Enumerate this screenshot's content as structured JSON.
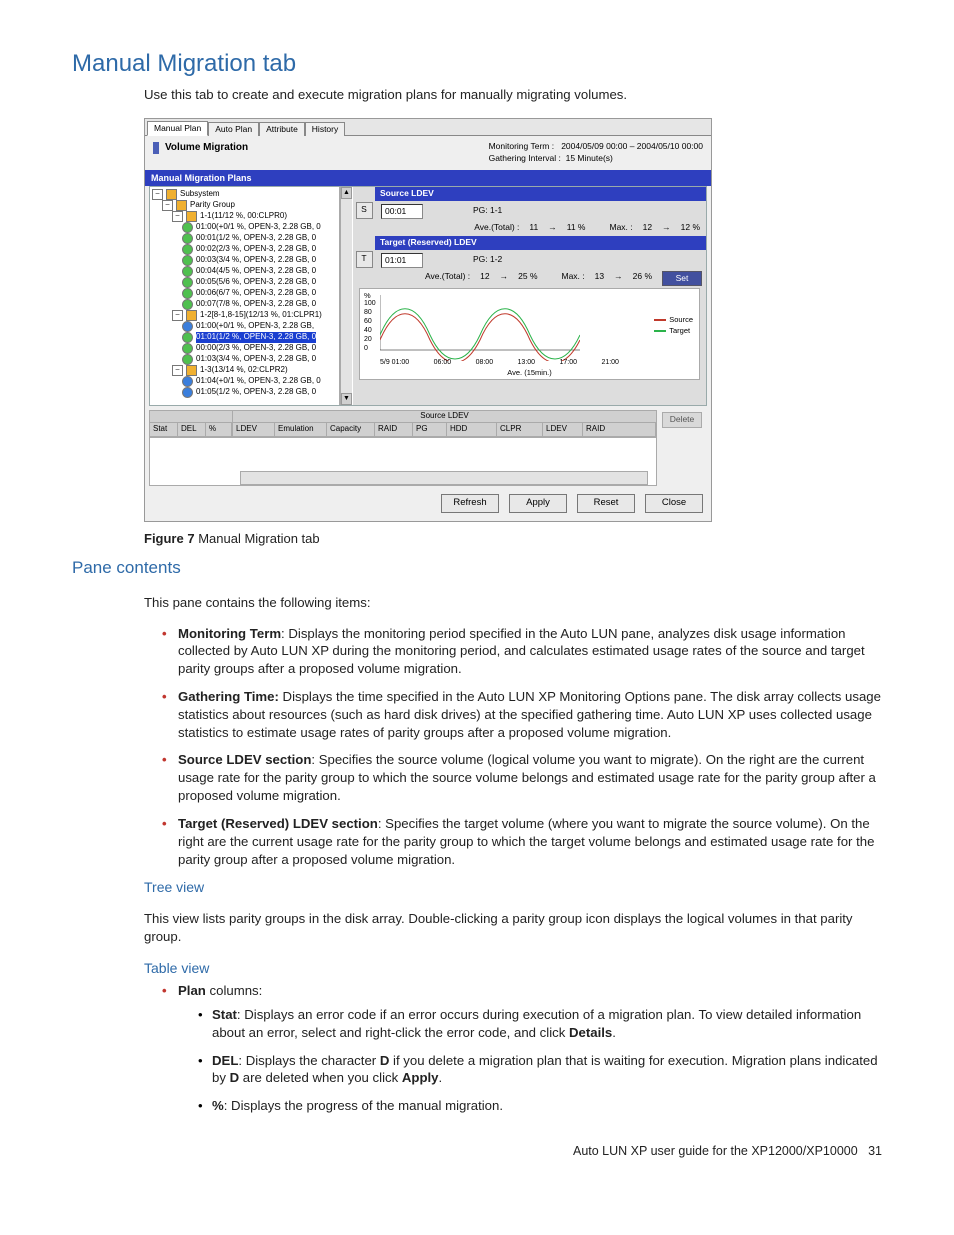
{
  "page_title": "Manual Migration tab",
  "lead": "Use this tab to create and execute migration plans for manually migrating volumes.",
  "figure": {
    "label": "Figure 7",
    "caption": "Manual Migration tab"
  },
  "shot": {
    "tabs": [
      "Manual Plan",
      "Auto Plan",
      "Attribute",
      "History"
    ],
    "vm_title": "Volume Migration",
    "meta": {
      "monitoring_term_label": "Monitoring Term :",
      "monitoring_term_value": "2004/05/09 00:00  –  2004/05/10 00:00",
      "gathering_label": "Gathering Interval :",
      "gathering_value": "15  Minute(s)"
    },
    "plans_bar": "Manual Migration Plans",
    "tree": {
      "root": "Subsystem",
      "pg_root": "Parity Group",
      "groups": [
        {
          "name": "1-1(11/12 %, 00:CLPR0)",
          "items": [
            "01:00(+0/1 %, OPEN-3, 2.28 GB, 0",
            "00:01(1/2 %, OPEN-3, 2.28 GB, 0",
            "00:02(2/3 %, OPEN-3, 2.28 GB, 0",
            "00:03(3/4 %, OPEN-3, 2.28 GB, 0",
            "00:04(4/5 %, OPEN-3, 2.28 GB, 0",
            "00:05(5/6 %, OPEN-3, 2.28 GB, 0",
            "00:06(6/7 %, OPEN-3, 2.28 GB, 0",
            "00:07(7/8 %, OPEN-3, 2.28 GB, 0"
          ]
        },
        {
          "name": "1-2[8-1,8-15](12/13 %, 01:CLPR1)",
          "items": [
            "01:00(+0/1 %, OPEN-3, 2.28 GB,",
            "01:01(1/2 %, OPEN-3, 2.28 GB, 0",
            "00:00(2/3 %, OPEN-3, 2.28 GB, 0",
            "01:03(3/4 %, OPEN-3, 2.28 GB, 0"
          ],
          "highlight_index": 1
        },
        {
          "name": "1-3(13/14 %, 02:CLPR2)",
          "items": [
            "01:04(+0/1 %, OPEN-3, 2.28 GB, 0",
            "01:05(1/2 %, OPEN-3, 2.28 GB, 0"
          ]
        }
      ]
    },
    "source": {
      "bar": "Source LDEV",
      "btn": "S",
      "value": "00:01",
      "pg": "PG: 1-1",
      "avg_label": "Ave.(Total) :",
      "avg_from": "11",
      "avg_to": "11 %",
      "max_label": "Max. :",
      "max_from": "12",
      "max_to": "12 %"
    },
    "target": {
      "bar": "Target (Reserved) LDEV",
      "btn": "T",
      "value": "01:01",
      "pg": "PG: 1-2",
      "avg_label": "Ave.(Total) :",
      "avg_from": "12",
      "avg_to": "25 %",
      "max_label": "Max. :",
      "max_from": "13",
      "max_to": "26 %"
    },
    "chart": {
      "ylabel": "%",
      "yticks": [
        "100",
        "80",
        "60",
        "40",
        "20",
        "0"
      ],
      "xticks": [
        "5/9 01:00",
        "06:00",
        "08:00",
        "13:00",
        "17:00",
        "21:00"
      ],
      "xaxis": "Ave. (15min.)",
      "legend": [
        "Source",
        "Target"
      ]
    },
    "set_btn": "Set",
    "delete_btn": "Delete",
    "table": {
      "span": "Source LDEV",
      "cols": [
        "Stat",
        "DEL",
        "%",
        "LDEV",
        "Emulation",
        "Capacity",
        "RAID",
        "PG",
        "HDD",
        "CLPR",
        "LDEV",
        "RAID"
      ]
    },
    "buttons": [
      "Refresh",
      "Apply",
      "Reset",
      "Close"
    ]
  },
  "pane_contents_h": "Pane contents",
  "pane_contents_lead": "This pane contains the following items:",
  "items": [
    {
      "t": "Monitoring Term",
      "d": ": Displays the monitoring period specified in the Auto LUN pane, analyzes disk usage information collected by Auto LUN XP during the monitoring period, and calculates estimated usage rates of the source and target parity groups after a proposed volume migration."
    },
    {
      "t": "Gathering Time:",
      "d": " Displays the time specified in the Auto LUN XP Monitoring Options pane. The disk array collects usage statistics about resources (such as hard disk drives) at the specified gathering time. Auto LUN XP uses collected usage statistics to estimate usage rates of parity groups after a proposed volume migration."
    },
    {
      "t": "Source LDEV section",
      "d": ": Specifies the source volume (logical volume you want to migrate). On the right are the current usage rate for the parity group to which the source volume belongs and estimated usage rate for the parity group after a proposed volume migration."
    },
    {
      "t": "Target (Reserved) LDEV section",
      "d": ": Specifies the target volume (where you want to migrate the source volume). On the right are the current usage rate for the parity group to which the target volume belongs and estimated usage rate for the parity group after a proposed volume migration."
    }
  ],
  "tree_view_h": "Tree view",
  "tree_view_body": "This view lists parity groups in the disk array. Double-clicking a parity group icon displays the logical volumes in that parity group.",
  "table_view_h": "Table view",
  "plan_label": "Plan",
  "plan_suffix": " columns:",
  "plan_cols": [
    {
      "t": "Stat",
      "d1": ": Displays an error code if an error occurs during execution of a migration plan. To view detailed information about an error, select and right-click the error code, and click ",
      "b": "Details",
      "d2": "."
    },
    {
      "t": "DEL",
      "d1": ": Displays the character ",
      "b": "D",
      "d2": " if you delete a migration plan that is waiting for execution. Migration plans indicated by ",
      "b2": "D",
      "d3": " are deleted when you click ",
      "b3": "Apply",
      "d4": "."
    },
    {
      "t": "%",
      "d1": ": Displays the progress of the manual migration."
    }
  ],
  "footer": {
    "text": "Auto LUN XP user guide for the XP12000/XP10000",
    "page": "31"
  }
}
